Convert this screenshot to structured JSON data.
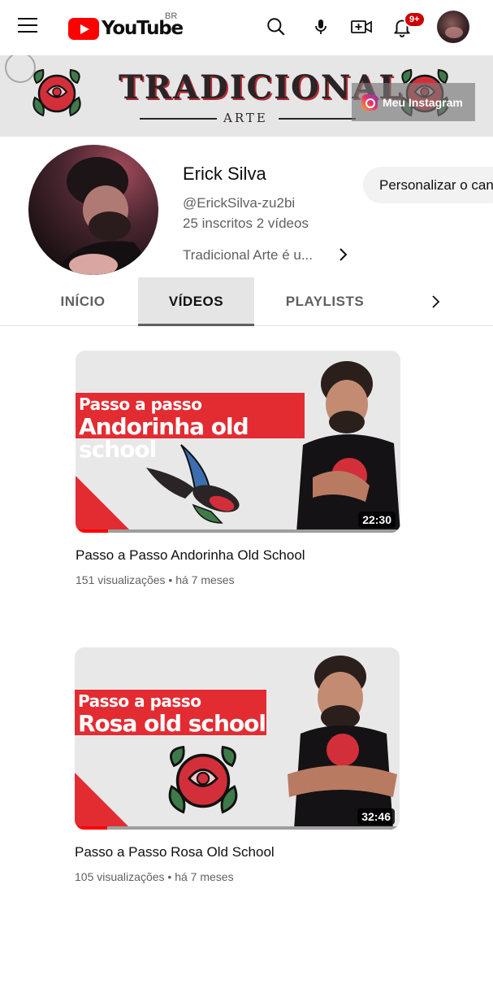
{
  "header": {
    "logo_text": "YouTube",
    "region": "BR",
    "notification_count": "9+"
  },
  "banner": {
    "title": "TRADICIONAL",
    "subtitle": "ARTE",
    "instagram_label": "Meu Instagram"
  },
  "channel": {
    "name": "Erick Silva",
    "handle": "@ErickSilva-zu2bi",
    "stats": "25 inscritos  2 vídeos",
    "description": "Tradicional Arte é u...",
    "customize_label": "Personalizar o canal"
  },
  "tabs": [
    {
      "label": "INÍCIO",
      "active": false
    },
    {
      "label": "VÍDEOS",
      "active": true
    },
    {
      "label": "PLAYLISTS",
      "active": false
    }
  ],
  "videos": [
    {
      "thumb_line1": "Passo a passo",
      "thumb_line2": "Andorinha old school",
      "duration": "22:30",
      "progress": 0.1,
      "title": "Passo a Passo Andorinha Old School",
      "meta": "151 visualizações • há 7 meses"
    },
    {
      "thumb_line1": "Passo a passo",
      "thumb_line2": "Rosa old school",
      "duration": "32:46",
      "progress": 0.1,
      "title": "Passo a Passo Rosa Old School",
      "meta": "105 visualizações • há 7 meses"
    }
  ],
  "colors": {
    "brand_red": "#ff0000",
    "thumb_red": "#e32b32",
    "secondary_text": "#606060"
  }
}
